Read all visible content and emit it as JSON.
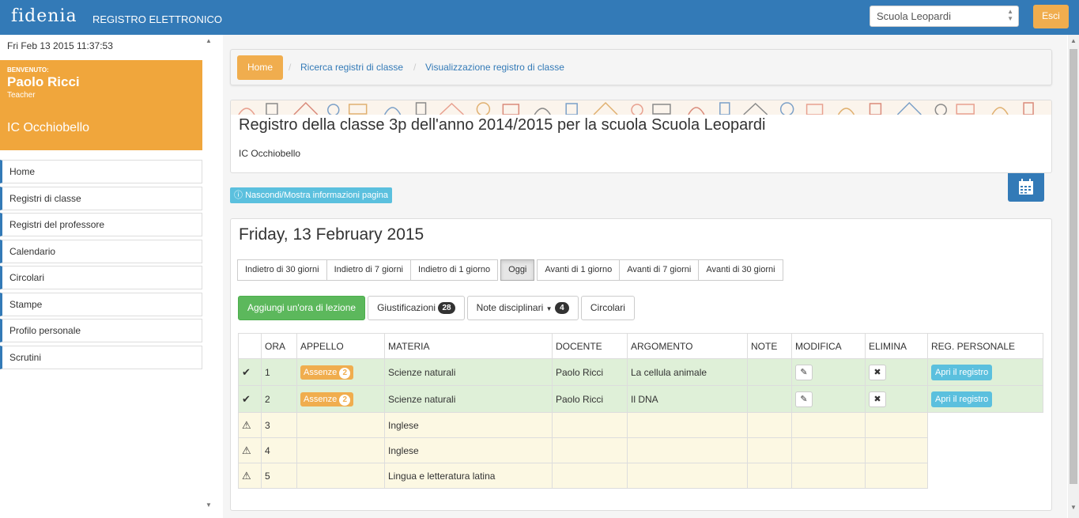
{
  "header": {
    "logo": "fidenia",
    "app_title": "REGISTRO ELETTRONICO",
    "school_select_value": "Scuola Leopardi",
    "exit_label": "Esci"
  },
  "sidebar": {
    "datetime": "Fri Feb 13 2015 11:37:53",
    "welcome_label": "BENVENUTO:",
    "user_name": "Paolo Ricci",
    "user_role": "Teacher",
    "institute": "IC Occhiobello",
    "items": [
      {
        "label": "Home"
      },
      {
        "label": "Registri di classe"
      },
      {
        "label": "Registri del professore"
      },
      {
        "label": "Calendario"
      },
      {
        "label": "Circolari"
      },
      {
        "label": "Stampe"
      },
      {
        "label": "Profilo personale"
      },
      {
        "label": "Scrutini"
      }
    ]
  },
  "breadcrumb": {
    "home": "Home",
    "sep": "/",
    "links": [
      "Ricerca registri di classe",
      "Visualizzazione registro di classe"
    ]
  },
  "page_header": {
    "title": "Registro della classe 3p dell'anno 2014/2015 per la scuola Scuola Leopardi",
    "subtitle": "IC Occhiobello",
    "toggle_info": "Nascondi/Mostra informazioni pagina",
    "calendar_icon": "calendar-icon"
  },
  "day": {
    "title": "Friday, 13 February 2015",
    "nav": [
      "Indietro di 30 giorni",
      "Indietro di 7 giorni",
      "Indietro di 1 giorno",
      "Oggi",
      "Avanti di 1 giorno",
      "Avanti di 7 giorni",
      "Avanti di 30 giorni"
    ],
    "add_lesson": "Aggiungi un'ora di lezione",
    "justifications": "Giustificazioni",
    "justifications_count": "28",
    "disciplinary_notes": "Note disciplinari",
    "notes_count": "4",
    "circulars": "Circolari"
  },
  "table": {
    "headers": [
      "",
      "ORA",
      "APPELLO",
      "MATERIA",
      "DOCENTE",
      "ARGOMENTO",
      "NOTE",
      "MODIFICA",
      "ELIMINA",
      "REG. PERSONALE"
    ],
    "absences_label": "Assenze",
    "open_register_label": "Apri il registro",
    "rows": [
      {
        "status": "ok",
        "ora": "1",
        "absences": "2",
        "materia": "Scienze naturali",
        "docente": "Paolo Ricci",
        "argomento": "La cellula animale"
      },
      {
        "status": "ok",
        "ora": "2",
        "absences": "2",
        "materia": "Scienze naturali",
        "docente": "Paolo Ricci",
        "argomento": "Il DNA"
      },
      {
        "status": "warn",
        "ora": "3",
        "materia": "Inglese"
      },
      {
        "status": "warn",
        "ora": "4",
        "materia": "Inglese"
      },
      {
        "status": "warn",
        "ora": "5",
        "materia": "Lingua e letteratura latina"
      }
    ]
  }
}
